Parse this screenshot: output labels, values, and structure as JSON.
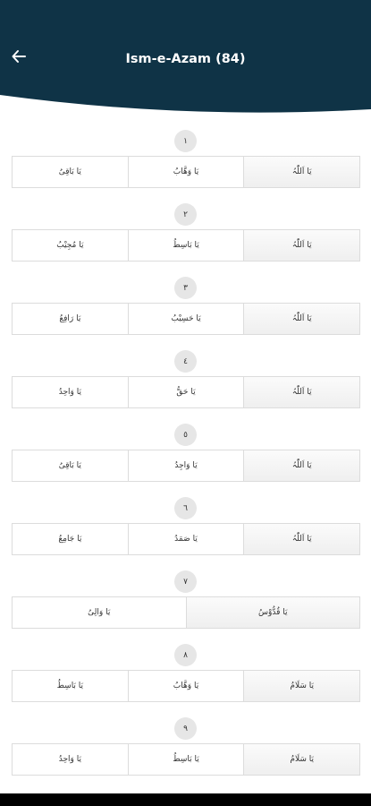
{
  "header": {
    "title": "Ism-e-Azam (84)",
    "back_icon": "arrow-left-icon",
    "background_color": "#0f3346"
  },
  "groups": [
    {
      "number": "١",
      "names": [
        "یَا اَللّٰہُ",
        "یَا وَھَّابُ",
        "یَا بَاقِیُ"
      ]
    },
    {
      "number": "٢",
      "names": [
        "یَا اَللّٰہُ",
        "یَا بَاسِطُ",
        "یَا مُجِیْبُ"
      ]
    },
    {
      "number": "٣",
      "names": [
        "یَا اَللّٰہُ",
        "یَا حَسِیْبُ",
        "یَا رَافِعُ"
      ]
    },
    {
      "number": "٤",
      "names": [
        "یَا اَللّٰہُ",
        "یَا حَقُّ",
        "یَا وَاحِدُ"
      ]
    },
    {
      "number": "٥",
      "names": [
        "یَا اَللّٰہُ",
        "یَا وَاجِدُ",
        "یَا بَاقِیُ"
      ]
    },
    {
      "number": "٦",
      "names": [
        "یَا اَللّٰہُ",
        "یَا صَمَدُ",
        "یَا جَامِعُ"
      ]
    },
    {
      "number": "٧",
      "names": [
        "یَا قُدُّوْسُ",
        "یَا وَالِیُ"
      ]
    },
    {
      "number": "٨",
      "names": [
        "یَا سَلَامُ",
        "یَا وَھَّابُ",
        "یَا بَاسِطُ"
      ]
    },
    {
      "number": "٩",
      "names": [
        "یَا سَلَامُ",
        "یَا بَاسِطُ",
        "یَا وَاحِدُ"
      ]
    }
  ]
}
